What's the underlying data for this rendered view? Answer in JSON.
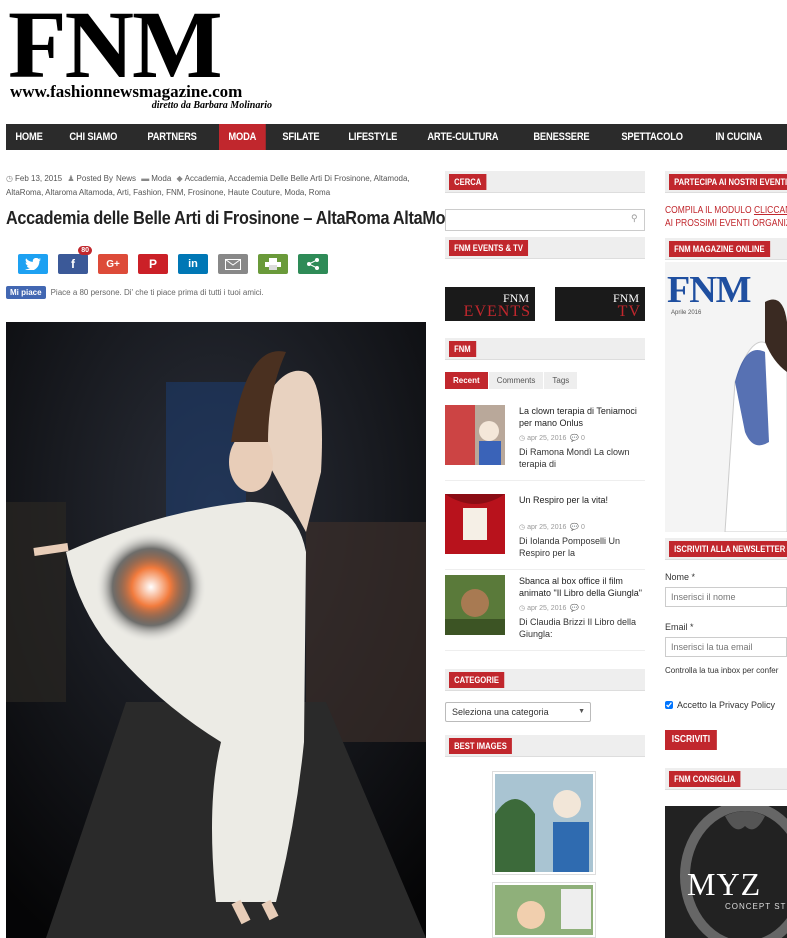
{
  "header": {
    "logo": "FNM",
    "url": "www.fashionnewsmagazine.com",
    "director": "diretto da Barbara Molinario"
  },
  "nav": [
    "HOME",
    "CHI SIAMO",
    "PARTNERS",
    "MODA",
    "SFILATE",
    "LIFESTYLE",
    "ARTE-CULTURA",
    "BENESSERE",
    "SPETTACOLO",
    "IN CUCINA"
  ],
  "nav_active": "MODA",
  "article": {
    "date": "Feb 13, 2015",
    "posted_by_label": "Posted By",
    "author": "News",
    "category": "Moda",
    "tags": "Accademia, Accademia Delle Belle Arti Di Frosinone, Altamoda, AltaRoma, Altaroma Altamoda, Arti, Fashion, FNM, Frosinone, Haute Couture, Moda, Roma",
    "title": "Accademia delle Belle Arti di Frosinone – AltaRoma AltaModa",
    "share_count": "80",
    "like_label": "Mi piace",
    "like_text": "Piace a 80 persone. Di' che ti piace prima di tutti i tuoi amici."
  },
  "sidebar": {
    "search_title": "CERCA",
    "events_title": "FNM EVENTS & TV",
    "events_box": {
      "top": "FNM",
      "bottom_1": "EVENTS",
      "bottom_2": "TV"
    },
    "fnm_title": "FNM",
    "tabs": [
      "Recent",
      "Comments",
      "Tags"
    ],
    "posts": [
      {
        "title": "La clown terapia di Teniamoci per mano Onlus",
        "date": "apr 25, 2016",
        "comments": "0",
        "excerpt": "Di Ramona Mondì La clown terapia di"
      },
      {
        "title": "Un Respiro per la vita!",
        "date": "apr 25, 2016",
        "comments": "0",
        "excerpt": "Di Iolanda Pomposelli Un Respiro per la"
      },
      {
        "title": "Sbanca al box office il film animato \"Il Libro della Giungla\"",
        "date": "apr 25, 2016",
        "comments": "0",
        "excerpt": "Di Claudia Brizzi Il Libro della Giungla:"
      }
    ],
    "categories_title": "CATEGORIE",
    "categories_select": "Seleziona una categoria",
    "best_images_title": "BEST IMAGES"
  },
  "right": {
    "events_title": "PARTECIPA AI NOSTRI EVENTI",
    "cta_prefix": "COMPILA IL MODULO ",
    "cta_link": "CLICCANDO",
    "cta_line2": "AI PROSSIMI EVENTI ORGANIZZA",
    "magazine_title": "FNM MAGAZINE ONLINE",
    "cover_logo": "FNM",
    "cover_date": "Aprile 2016",
    "newsletter_title": "ISCRIVITI ALLA NEWSLETTER",
    "name_label": "Nome *",
    "name_placeholder": "Inserisci il nome",
    "email_label": "Email *",
    "email_placeholder": "Inserisci la tua email",
    "inbox_text": "Controlla la tua inbox per confer",
    "privacy_label": "Accetto la Privacy Policy",
    "subscribe_label": "ISCRIVITI",
    "consiglia_title": "FNM CONSIGLIA",
    "ad_text": "MYZ",
    "ad_sub": "CONCEPT ST"
  },
  "colors": {
    "accent": "#c1272d",
    "nav_bg": "#2b2b2b"
  }
}
